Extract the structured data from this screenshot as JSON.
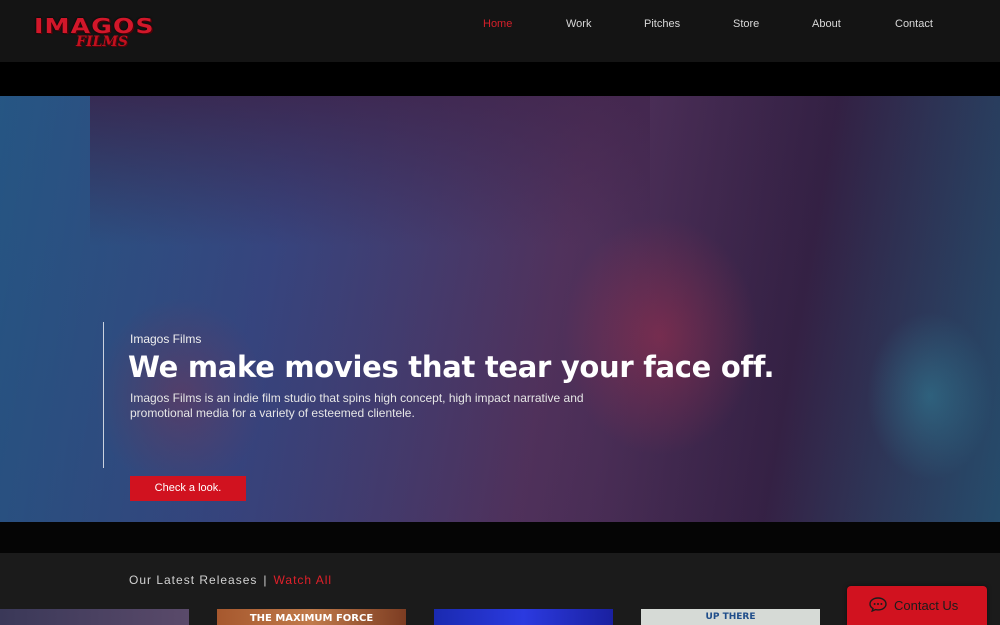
{
  "brand": {
    "logo_line1": "IMAGOS",
    "logo_line2": "FILMS",
    "accent": "#d1121f"
  },
  "nav": {
    "items": [
      {
        "label": "Home",
        "active": true
      },
      {
        "label": "Work",
        "active": false
      },
      {
        "label": "Pitches",
        "active": false
      },
      {
        "label": "Store",
        "active": false
      },
      {
        "label": "About",
        "active": false
      },
      {
        "label": "Contact",
        "active": false
      }
    ]
  },
  "hero": {
    "eyebrow": "Imagos Films",
    "headline": "We make movies that tear your face off.",
    "description": "Imagos Films is an indie film studio that spins high concept, high impact narrative and promotional media for a variety of esteemed clientele.",
    "cta_label": "Check a look."
  },
  "releases": {
    "heading": "Our Latest Releases",
    "separator": "|",
    "watch_all": "Watch All",
    "thumbs": [
      {
        "caption": ""
      },
      {
        "caption": "THE MAXIMUM FORCE"
      },
      {
        "caption": ""
      },
      {
        "caption": "UP THERE"
      }
    ]
  },
  "contact_widget": {
    "label": "Contact Us",
    "icon": "chat-bubble-icon"
  }
}
